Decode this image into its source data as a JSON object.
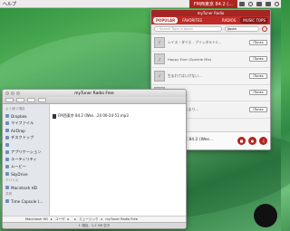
{
  "menubar": {
    "app_label": "ヘルプ",
    "status_app": "FM西東京 84.2 (..."
  },
  "radio": {
    "window_title": "myTuner Radio",
    "tabs": [
      "POPULAR",
      "FAVORITES",
      "RADIOS",
      "MUSIC TOPS"
    ],
    "search_placeholder": "Search Tops in Japan",
    "country": "Japan",
    "items": [
      {
        "title": "レイス・ダイス - ブリッタルト2…",
        "itunes": "iTunes"
      },
      {
        "title": "Happy Ever (Sparkle Mix)",
        "itunes": "iTunes"
      },
      {
        "title": "生まれてはいけない…",
        "itunes": "iTunes"
      },
      {
        "title": "Happily",
        "itunes": "iTunes"
      },
      {
        "title": "とびらのはじまり…",
        "itunes": "iTunes"
      }
    ],
    "player": {
      "station": "FM西東京 84.2 (Wes…",
      "status": "Playing"
    }
  },
  "finder": {
    "title": "myTuner Radio Free",
    "sidebar_sections": [
      {
        "heading": "よく使う項目",
        "items": [
          "Dropbox",
          "マイファイル",
          "AirDrop",
          "デスクトップ",
          "",
          "アプリケーション",
          "ユーティリティ",
          "ムービー",
          "SkyDrive"
        ]
      },
      {
        "heading": "デバイス",
        "items": [
          "Macintosh HD"
        ]
      },
      {
        "heading": "共有",
        "items": [
          "Time Capsule (…"
        ]
      }
    ],
    "file": "FM西東京 84.2 (Wes…24 00-24-51.mp3",
    "path": [
      "Macintosh HD",
      "ユーザ",
      "",
      "ミュージック",
      "myTuner Radio Free"
    ],
    "status": "1 項目、1.2 GB 空き"
  }
}
